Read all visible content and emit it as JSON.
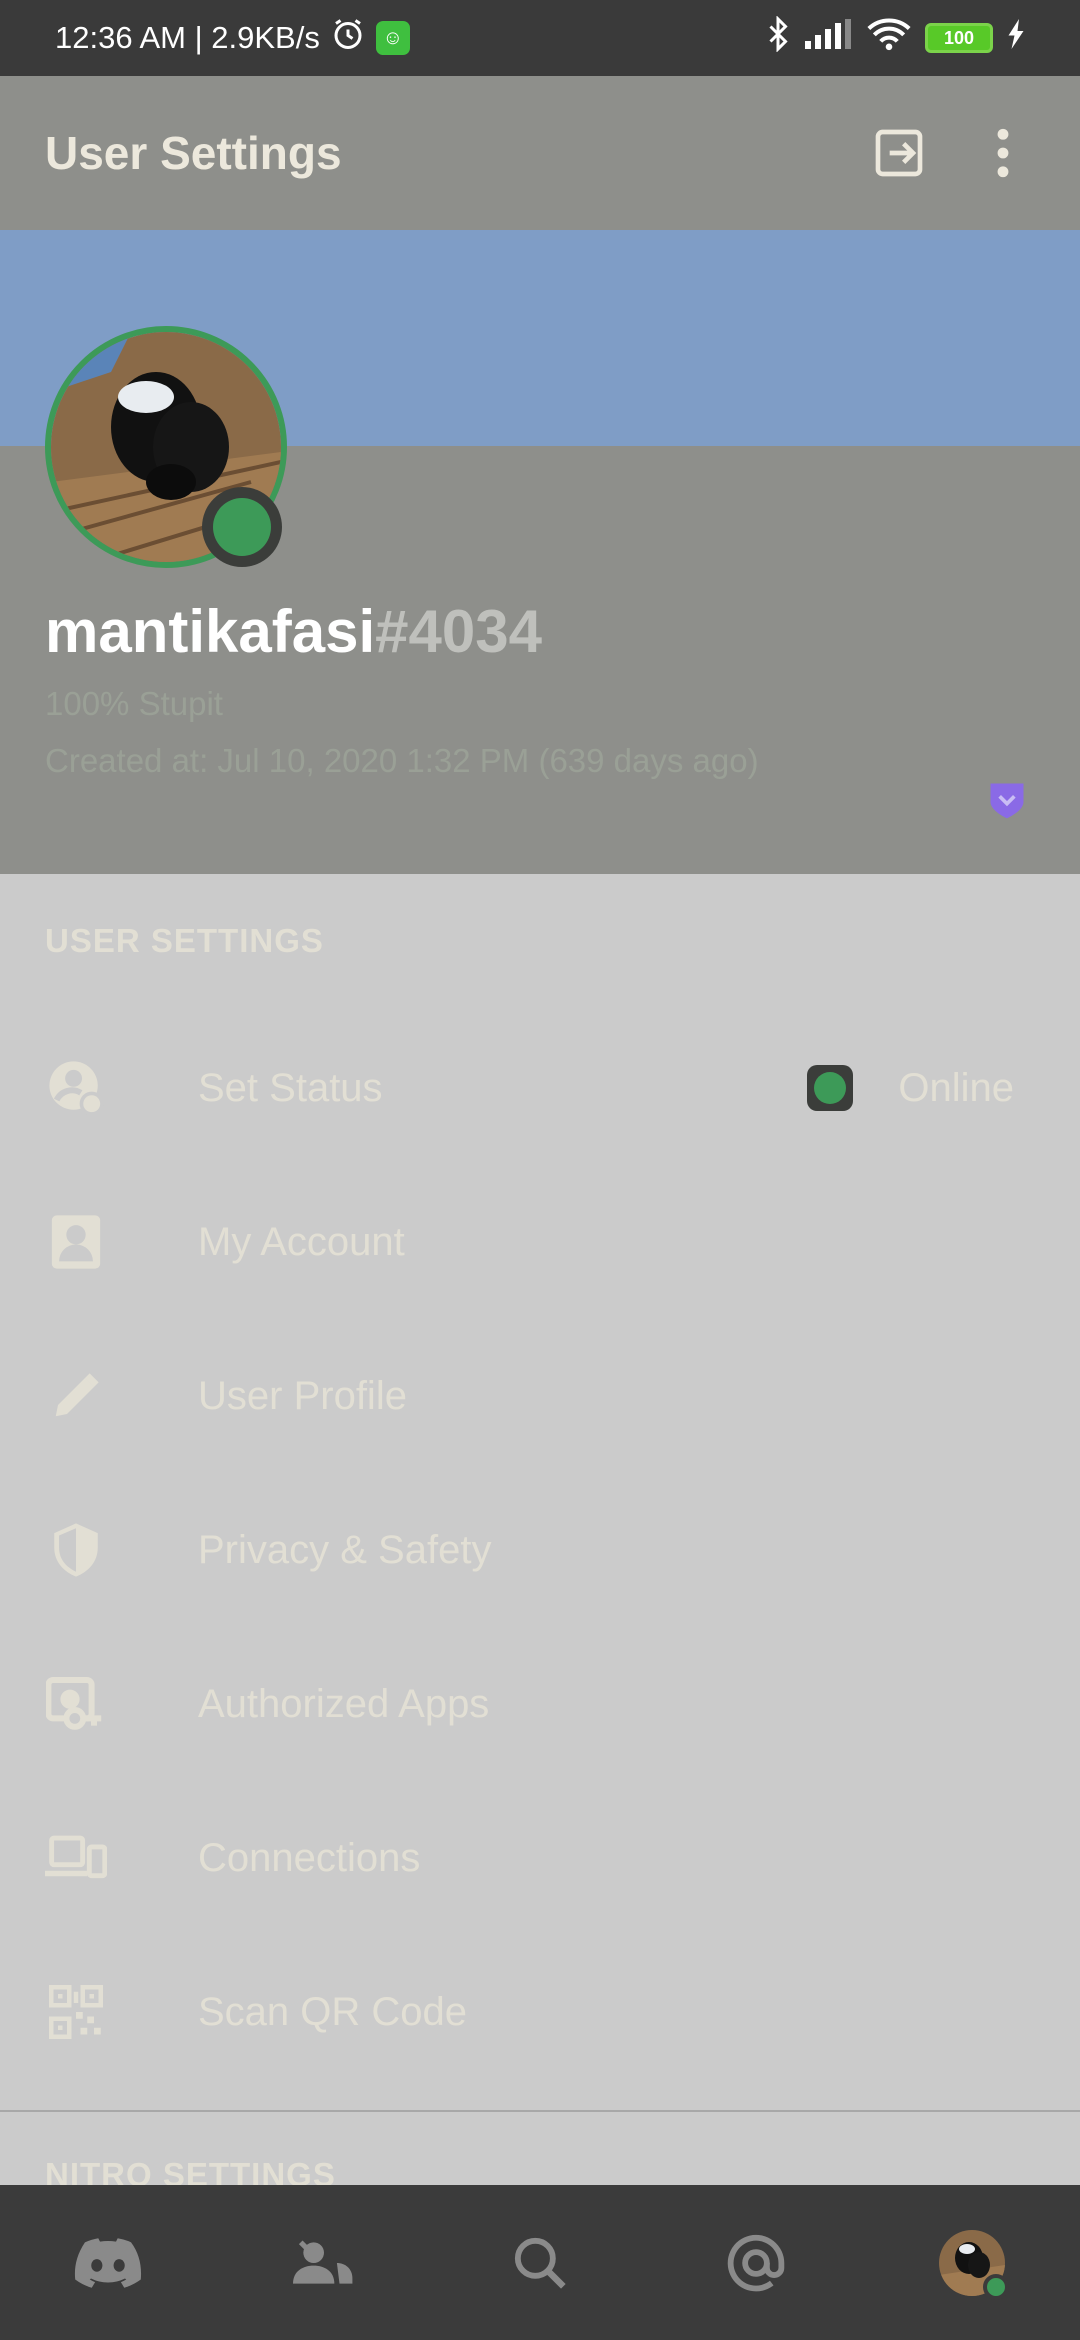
{
  "status_bar": {
    "time_speed": "12:36 AM | 2.9KB/s",
    "battery": "100"
  },
  "app_bar": {
    "title": "User Settings"
  },
  "profile": {
    "username": "mantikafasi",
    "discriminator": "#4034",
    "custom_status": "100% Stupit",
    "created_at": "Created at: Jul 10, 2020 1:32 PM (639 days ago)"
  },
  "user_settings": {
    "header": "USER SETTINGS",
    "items": [
      {
        "label": "Set Status",
        "value": "Online",
        "icon": "status-face-icon"
      },
      {
        "label": "My Account",
        "icon": "account-card-icon"
      },
      {
        "label": "User Profile",
        "icon": "pencil-icon"
      },
      {
        "label": "Privacy & Safety",
        "icon": "shield-icon"
      },
      {
        "label": "Authorized Apps",
        "icon": "apps-key-icon"
      },
      {
        "label": "Connections",
        "icon": "devices-icon"
      },
      {
        "label": "Scan QR Code",
        "icon": "qr-code-icon"
      }
    ]
  },
  "nitro_settings": {
    "header": "NITRO SETTINGS"
  },
  "bottom_nav": {
    "items": [
      "discord-home-icon",
      "friends-icon",
      "search-icon",
      "mentions-icon",
      "profile-avatar"
    ]
  },
  "colors": {
    "online": "#3d9a58",
    "banner": "#7f9dc6",
    "nitro_badge": "#8a6ae6"
  }
}
